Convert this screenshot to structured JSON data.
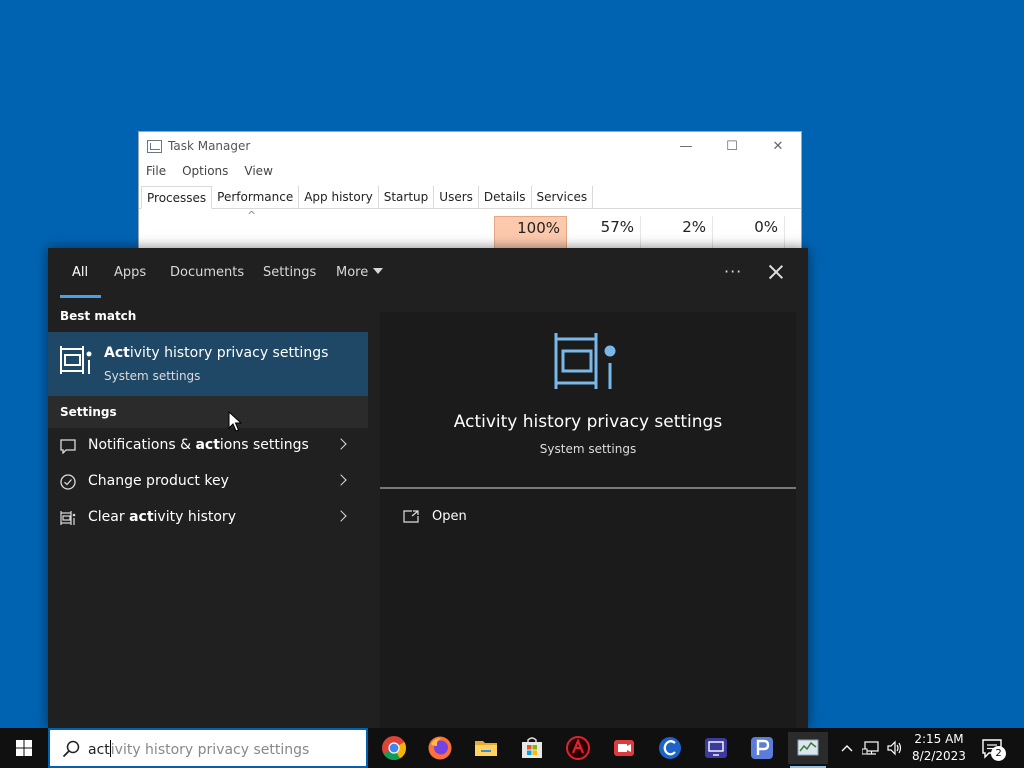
{
  "task_manager": {
    "title": "Task Manager",
    "controls": {
      "minimize": "—",
      "maximize": "☐",
      "close": "✕"
    },
    "menu": [
      "File",
      "Options",
      "View"
    ],
    "tabs": [
      "Processes",
      "Performance",
      "App history",
      "Startup",
      "Users",
      "Details",
      "Services"
    ],
    "active_tab": "Processes",
    "sort_caret": "^",
    "columns": {
      "cpu": "100%",
      "memory": "57%",
      "disk": "2%",
      "network": "0%"
    }
  },
  "search_panel": {
    "tabs": {
      "all": "All",
      "apps": "Apps",
      "documents": "Documents",
      "settings": "Settings",
      "more": "More"
    },
    "more_options": "···",
    "best_match_heading": "Best match",
    "best_match": {
      "title_bold": "Act",
      "title_rest": "ivity history privacy settings",
      "subtitle": "System settings"
    },
    "settings_heading": "Settings",
    "settings_items": [
      {
        "pre": "Notifications & ",
        "bold": "act",
        "post": "ions settings"
      },
      {
        "pre": "Change product key",
        "bold": "",
        "post": ""
      },
      {
        "pre": "Clear ",
        "bold": "act",
        "post": "ivity history"
      }
    ],
    "preview": {
      "title": "Activity history privacy settings",
      "subtitle": "System settings",
      "open_label": "Open"
    }
  },
  "taskbar": {
    "search_typed": "act",
    "search_suggestion": "ivity history privacy settings",
    "apps": [
      "chrome-icon",
      "firefox-icon",
      "file-explorer-icon",
      "microsoft-store-icon",
      "red-app-icon",
      "screen-recorder-icon",
      "ccleaner-icon",
      "remote-desktop-icon",
      "p-app-icon",
      "task-manager-icon"
    ],
    "time": "2:15 AM",
    "date": "8/2/2023",
    "notification_count": "2"
  },
  "colors": {
    "desktop": "#0063b1",
    "panel_bg": "#202020",
    "highlight": "#1f4766",
    "accent": "#4aa0e6",
    "cpu_heat": "#fcc9ad"
  }
}
